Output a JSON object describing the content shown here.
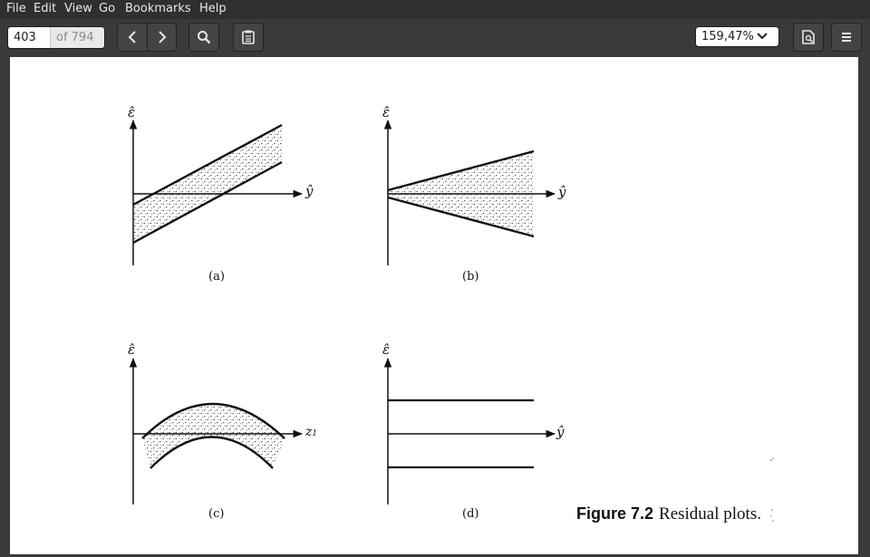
{
  "menu": {
    "file": "File",
    "edit": "Edit",
    "view": "View",
    "go": "Go",
    "bookmarks": "Bookmarks",
    "help": "Help"
  },
  "toolbar": {
    "page_number": "403",
    "page_count": "of 794",
    "zoom_level": "159,47%"
  },
  "figure": {
    "captions": [
      "(a)",
      "(b)",
      "(c)",
      "(d)"
    ],
    "axis_labels": {
      "epsilon_hat": "ε̂",
      "y_hat": "ŷ",
      "z1": "z",
      "z1_sub": "1"
    },
    "figure_label": "Figure 7.2",
    "figure_title": "Residual plots."
  }
}
